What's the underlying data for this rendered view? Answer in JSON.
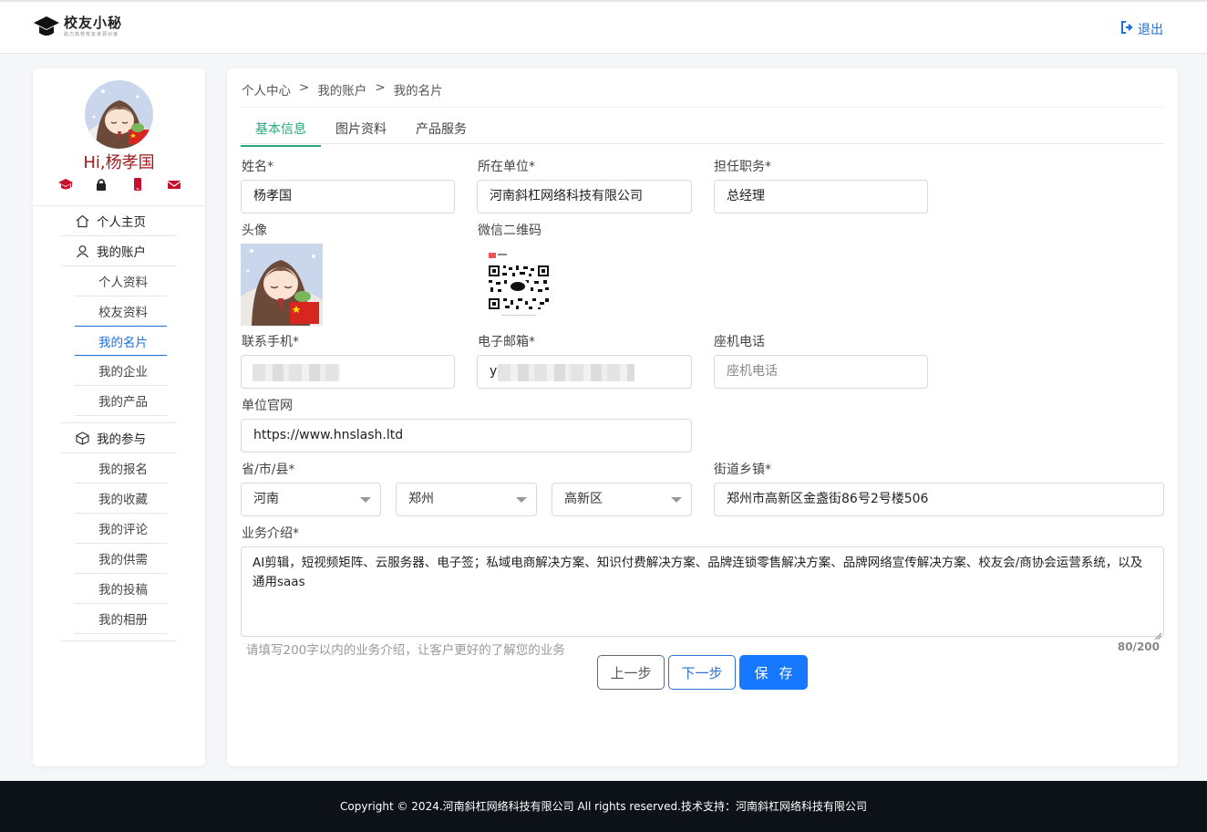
{
  "header": {
    "logo_title": "校友小秘",
    "logo_subtitle": "助力高校校友资源对接",
    "logout_label": "退出"
  },
  "sidebar": {
    "greeting": "Hi,杨孝国",
    "quick_icons": [
      "graduation-cap-icon",
      "lock-icon",
      "phone-icon",
      "mail-icon"
    ],
    "menu": {
      "home": "个人主页",
      "account": "我的账户",
      "account_items": [
        "个人资料",
        "校友资料",
        "我的名片",
        "我的企业",
        "我的产品"
      ],
      "active_item": "我的名片",
      "participation": "我的参与",
      "participation_items": [
        "我的报名",
        "我的收藏",
        "我的评论",
        "我的供需",
        "我的投稿",
        "我的相册"
      ]
    }
  },
  "breadcrumb": [
    "个人中心",
    ">",
    "我的账户",
    ">",
    "我的名片"
  ],
  "tabs": [
    {
      "label": "基本信息",
      "active": true
    },
    {
      "label": "图片资料",
      "active": false
    },
    {
      "label": "产品服务",
      "active": false
    }
  ],
  "form": {
    "name": {
      "label": "姓名*",
      "value": "杨孝国"
    },
    "company": {
      "label": "所在单位*",
      "value": "河南斜杠网络科技有限公司"
    },
    "position": {
      "label": "担任职务*",
      "value": "总经理"
    },
    "avatar_label": "头像",
    "wechat_qr_label": "微信二维码",
    "mobile": {
      "label": "联系手机*",
      "value": ""
    },
    "email": {
      "label": "电子邮箱*",
      "value": "y"
    },
    "landline": {
      "label": "座机电话",
      "placeholder": "座机电话"
    },
    "website": {
      "label": "单位官网",
      "value": "https://www.hnslash.ltd"
    },
    "region": {
      "label": "省/市/县*",
      "province": "河南",
      "city": "郑州",
      "district": "高新区"
    },
    "street": {
      "label": "街道乡镇*",
      "value": "郑州市高新区金盏街86号2号楼506"
    },
    "business": {
      "label": "业务介绍*",
      "value": "AI剪辑，短视频矩阵、云服务器、电子签；私域电商解决方案、知识付费解决方案、品牌连锁零售解决方案、品牌网络宣传解决方案、校友会/商协会运营系统，以及通用saas",
      "hint": "请填写200字以内的业务介绍，让客户更好的了解您的业务",
      "counter": "80/200"
    }
  },
  "buttons": {
    "prev": "上一步",
    "next": "下一步",
    "save": "保存"
  },
  "footer": {
    "copyright": "Copyright © 2024.河南斜杠网络科技有限公司 All rights reserved.技术支持：河南斜杠网络科技有限公司"
  },
  "colors": {
    "accent": "#1677ff",
    "tab_active": "#27a87e",
    "greeting": "#a31a1a",
    "icon_red": "#c8102e",
    "footer_bg": "#0d1218"
  }
}
